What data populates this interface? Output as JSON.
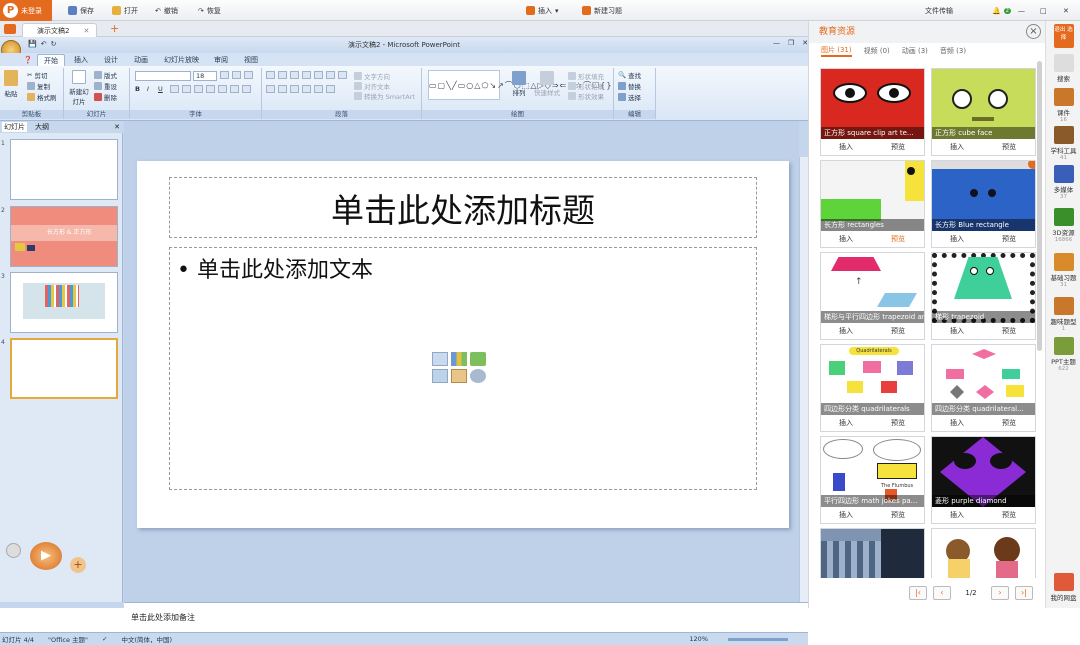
{
  "topbar": {
    "login": "未登录",
    "save": "保存",
    "open": "打开",
    "undo": "撤销",
    "redo": "恢复",
    "insert": "插入",
    "new_exercise": "新建习题",
    "file_transfer": "文件传输",
    "badge": "2"
  },
  "doc_tab": {
    "name": "演示文稿2",
    "add": "+"
  },
  "ppt": {
    "title": "演示文稿2 - Microsoft PowerPoint",
    "tabs": [
      "开始",
      "插入",
      "设计",
      "动画",
      "幻灯片放映",
      "审阅",
      "视图"
    ],
    "groups": {
      "clipboard": "剪贴板",
      "slides": "幻灯片",
      "font": "字体",
      "paragraph": "段落",
      "drawing": "绘图",
      "editing": "编辑"
    },
    "clipboard": {
      "paste": "粘贴",
      "cut": "剪切",
      "copy": "复制",
      "format_painter": "格式刷"
    },
    "slides": {
      "new_slide": "新建幻灯片",
      "layout": "版式",
      "reset": "重设",
      "delete": "删除"
    },
    "font": {
      "size": "18"
    },
    "paragraph": {
      "text_direction": "文字方向",
      "align_text": "对齐文本",
      "smartart": "转换为 SmartArt"
    },
    "drawing": {
      "arrange": "排列",
      "quick_styles": "快速样式",
      "shape_fill": "形状填充",
      "shape_outline": "形状轮廓",
      "shape_effects": "形状效果"
    },
    "editing": {
      "find": "查找",
      "replace": "替换",
      "select": "选择"
    },
    "pane_tabs": [
      "幻灯片",
      "大纲"
    ],
    "slide_numbers": [
      "1",
      "2",
      "3",
      "4"
    ],
    "thumb2_text": "长方形 & 正方形",
    "title_placeholder": "单击此处添加标题",
    "body_placeholder": "单击此处添加文本",
    "notes": "单击此处添加备注",
    "status": {
      "slide": "幻灯片 4/4",
      "theme": "\"Office 主题\"",
      "lang": "中文(简体，中国)",
      "zoom": "120%"
    }
  },
  "edu": {
    "title": "教育资源",
    "close": "×",
    "tabs": [
      {
        "label": "图片",
        "count": "(31)"
      },
      {
        "label": "视频",
        "count": "(0)"
      },
      {
        "label": "动画",
        "count": "(3)"
      },
      {
        "label": "音频",
        "count": "(3)"
      }
    ],
    "insert": "插入",
    "preview": "预览",
    "cards": [
      "正方形 square clip art te...",
      "正方形 cube face",
      "长方形 rectangles",
      "长方形 Blue rectangle",
      "梯形与平行四边形 trapezoid and parallelogram",
      "梯形 trapezoid",
      "四边形分类 quadrilaterals",
      "四边形分类 quadrilateral...",
      "平行四边形 math jokes pa...",
      "菱形 purple diamond",
      "",
      ""
    ],
    "card_thumb_text": [
      "Quadrilaterals",
      "The Flumbus"
    ],
    "pager": {
      "page": "1/2"
    }
  },
  "sidebar": [
    {
      "label": "退出 选择",
      "count": ""
    },
    {
      "label": "搜索",
      "count": ""
    },
    {
      "label": "课件",
      "count": "16"
    },
    {
      "label": "学科工具",
      "count": "41"
    },
    {
      "label": "多媒体",
      "count": "37"
    },
    {
      "label": "3D资源",
      "count": "16866"
    },
    {
      "label": "基础习题",
      "count": "31"
    },
    {
      "label": "趣味题型",
      "count": "1"
    },
    {
      "label": "PPT主题",
      "count": "622"
    },
    {
      "label": "我的网盘",
      "count": ""
    }
  ],
  "colors": {
    "accent": "#e46a1e",
    "ribbon": "#d5e3f5",
    "slide_bg": "#bfd1e9"
  }
}
